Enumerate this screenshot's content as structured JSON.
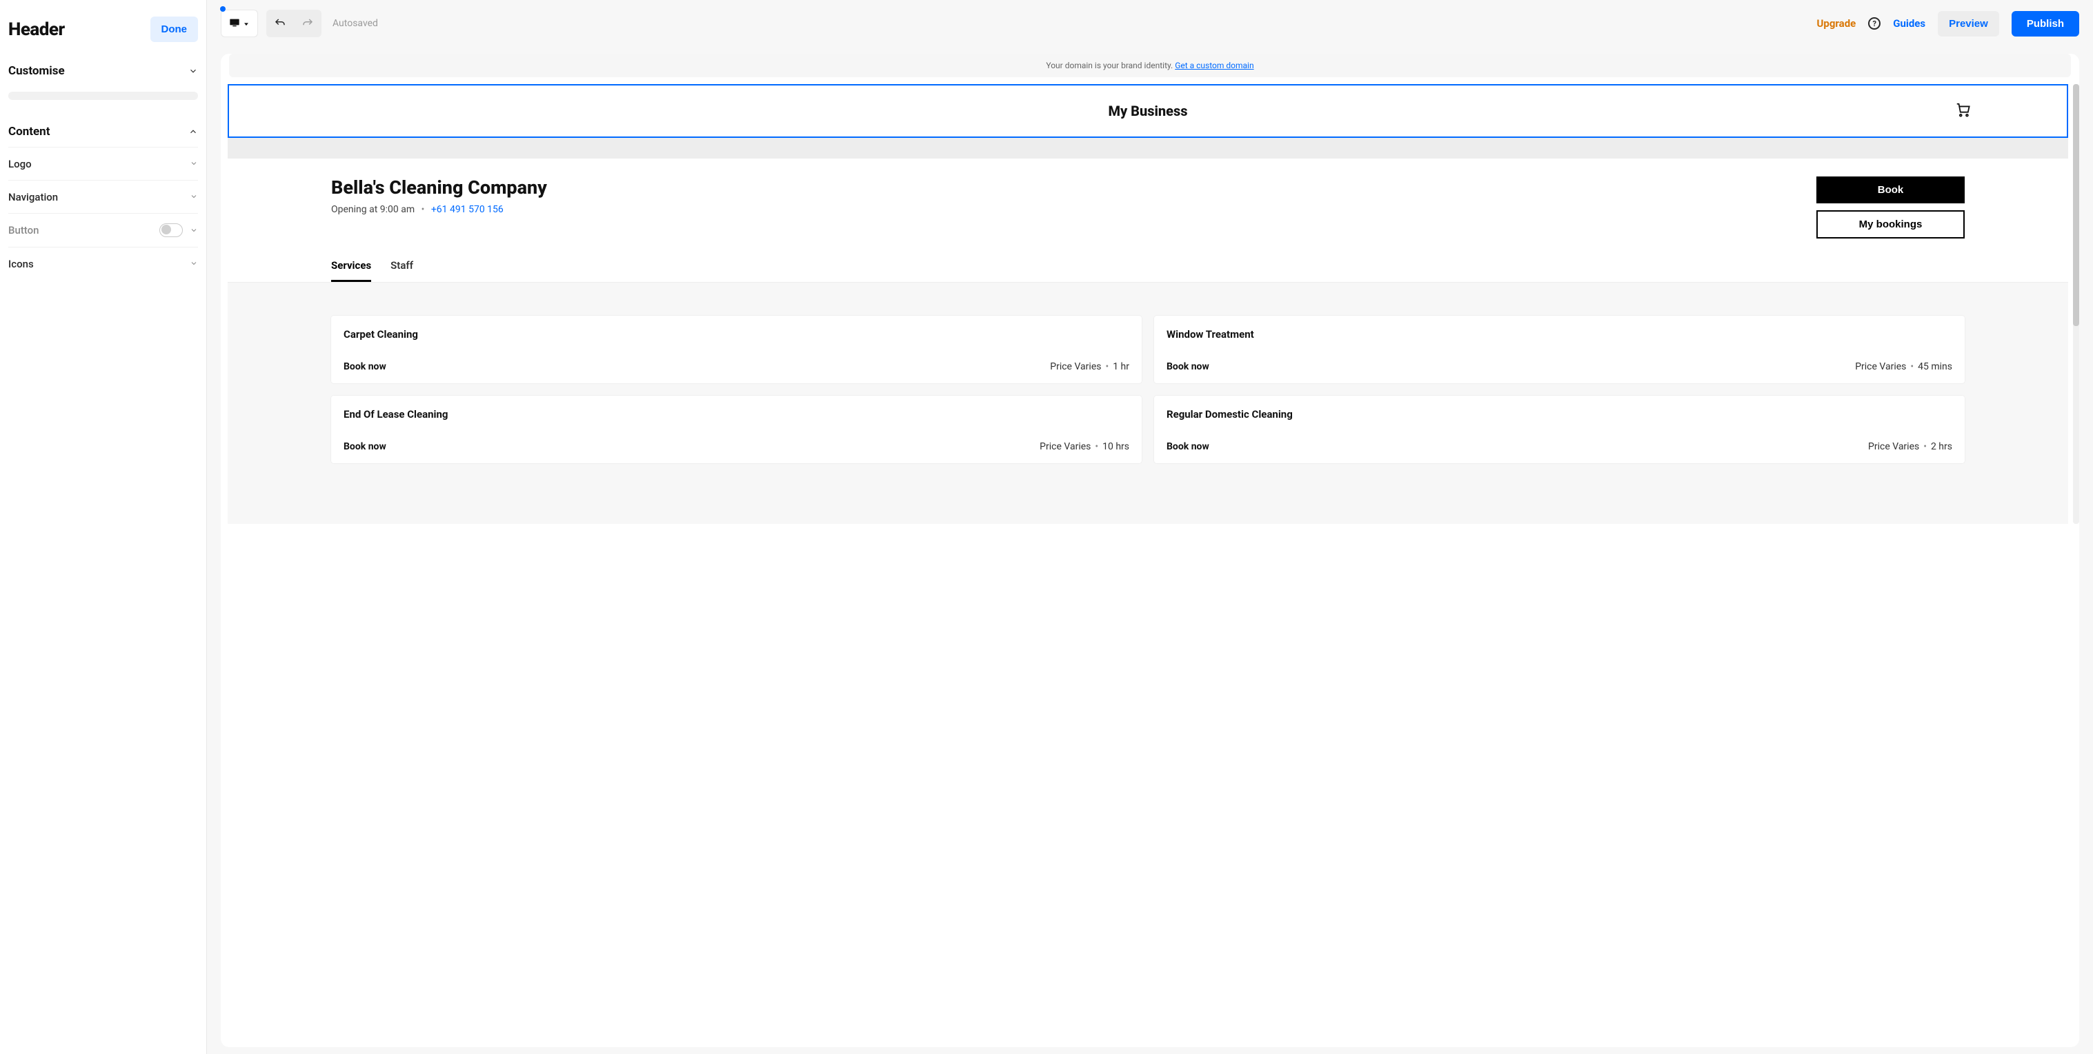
{
  "sidebar": {
    "title": "Header",
    "done_label": "Done",
    "customise": {
      "label": "Customise"
    },
    "content": {
      "label": "Content",
      "items": {
        "logo": "Logo",
        "navigation": "Navigation",
        "button": "Button",
        "icons": "Icons"
      }
    }
  },
  "topbar": {
    "autosaved": "Autosaved",
    "upgrade": "Upgrade",
    "guides": "Guides",
    "preview": "Preview",
    "publish": "Publish"
  },
  "banner": {
    "text": "Your domain is your brand identity. ",
    "link": "Get a custom domain"
  },
  "site": {
    "brand": "My Business",
    "business": {
      "name": "Bella's Cleaning Company",
      "opening": "Opening at 9:00 am",
      "phone": "+61 491 570 156"
    },
    "cta": {
      "book": "Book",
      "my_bookings": "My bookings"
    },
    "tabs": {
      "services": "Services",
      "staff": "Staff"
    },
    "services": [
      {
        "title": "Carpet Cleaning",
        "price": "Price Varies",
        "duration": "1 hr",
        "book": "Book now"
      },
      {
        "title": "Window Treatment",
        "price": "Price Varies",
        "duration": "45 mins",
        "book": "Book now"
      },
      {
        "title": "End Of Lease Cleaning",
        "price": "Price Varies",
        "duration": "10 hrs",
        "book": "Book now"
      },
      {
        "title": "Regular Domestic Cleaning",
        "price": "Price Varies",
        "duration": "2 hrs",
        "book": "Book now"
      }
    ]
  }
}
